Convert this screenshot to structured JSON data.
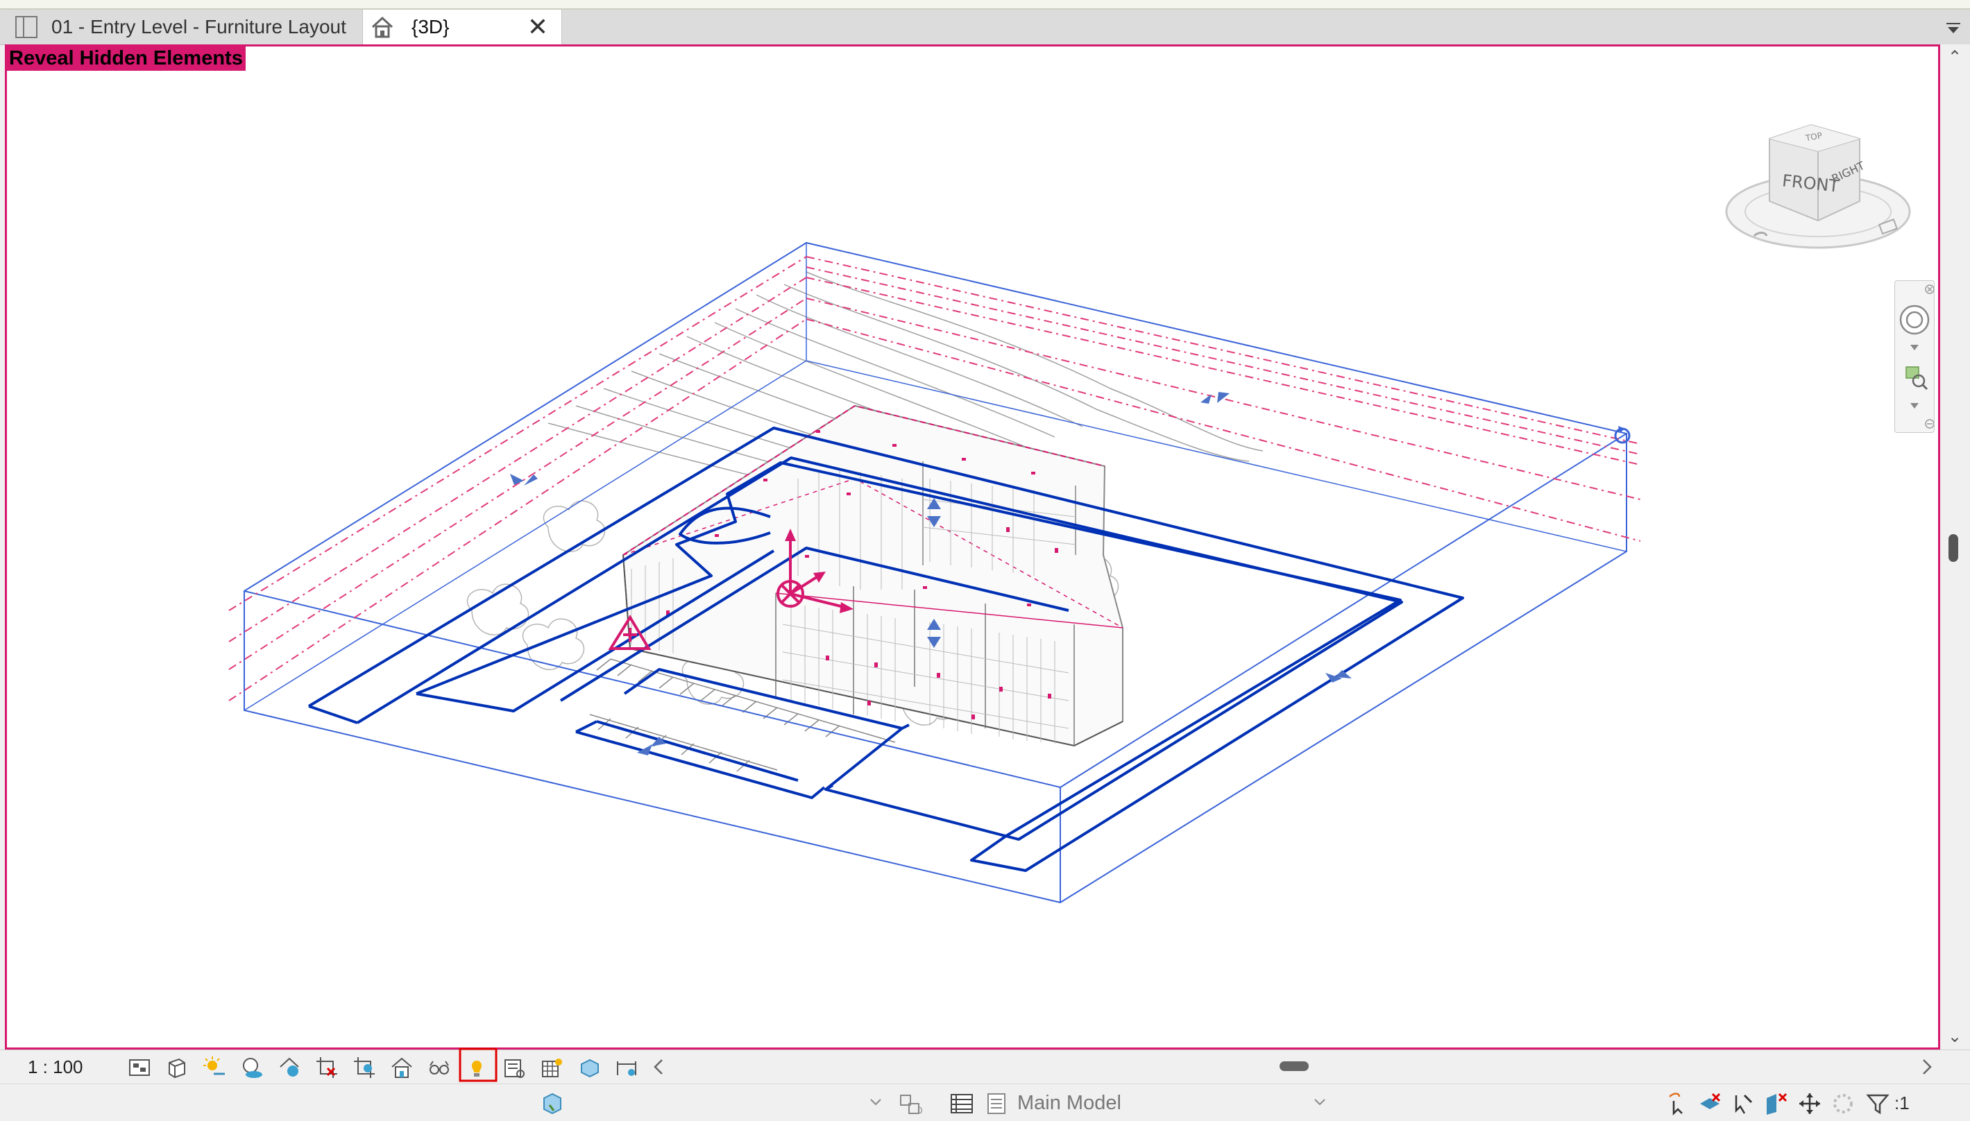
{
  "tabs": [
    {
      "label": "01 - Entry Level - Furniture Layout",
      "icon": "floor-plan-icon",
      "active": false
    },
    {
      "label": "{3D}",
      "icon": "house-3d-icon",
      "active": true
    }
  ],
  "tab_close_icon": "close-icon",
  "viewport": {
    "mode_label": "Reveal Hidden Elements",
    "mode_color": "#d6186e",
    "viewcube": {
      "front": "FRONT",
      "right": "RIGHT",
      "top": "TOP"
    }
  },
  "view_control_bar": {
    "scale": "1 : 100",
    "icons": [
      "detail-level-icon",
      "visual-style-icon",
      "sun-path-icon",
      "shadows-icon",
      "render-icon",
      "crop-view-icon",
      "show-crop-icon",
      "unlock-3d-icon",
      "temporary-hide-icon",
      "reveal-hidden-elements-icon",
      "temporary-view-properties-icon",
      "worksharing-display-icon",
      "show-constraints-icon",
      "analytical-model-icon",
      "highlight-displacement-icon"
    ],
    "active_icon": "reveal-hidden-elements-icon",
    "highlight_color": "#e00000"
  },
  "status_bar": {
    "model_label": "Main Model",
    "filter_count": ":1",
    "icons": [
      "editable-only-icon",
      "workset-icon",
      "design-options-icon",
      "select-links-icon",
      "select-underlay-icon",
      "select-pinned-icon",
      "select-by-face-icon",
      "drag-elements-icon",
      "background-process-icon",
      "filter-icon"
    ]
  },
  "colors": {
    "accent": "#d6186e",
    "model_blue": "#0030b4",
    "scope_blue": "#3a63d8"
  }
}
